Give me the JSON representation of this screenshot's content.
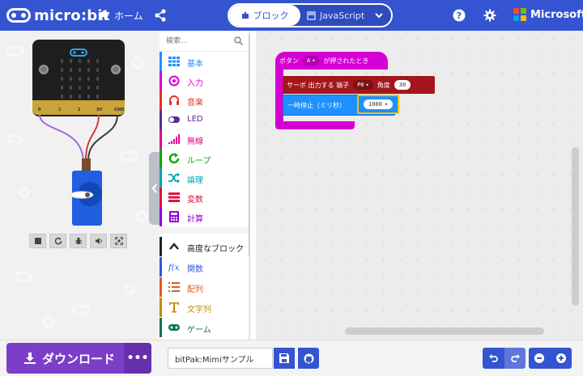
{
  "header": {
    "logo_text": "micro:bit",
    "home_label": "ホーム",
    "mode_blocks_label": "ブロック",
    "mode_js_label": "JavaScript",
    "brand_label": "Microsoft"
  },
  "simulator": {
    "pins": [
      "0",
      "1",
      "2",
      "3V",
      "GND"
    ]
  },
  "toolbox": {
    "search_placeholder": "検索...",
    "categories": [
      {
        "label": "基本",
        "color": "#1e90ff",
        "icon": "grid-icon"
      },
      {
        "label": "入力",
        "color": "#d400d4",
        "icon": "circle-target-icon"
      },
      {
        "label": "音楽",
        "color": "#e63022",
        "icon": "headphones-icon"
      },
      {
        "label": "LED",
        "color": "#5c2d91",
        "icon": "toggle-icon"
      },
      {
        "label": "無線",
        "color": "#e3008c",
        "icon": "signal-bars-icon"
      },
      {
        "label": "ループ",
        "color": "#00aa00",
        "icon": "refresh-icon"
      },
      {
        "label": "論理",
        "color": "#00a4a6",
        "icon": "shuffle-icon"
      },
      {
        "label": "変数",
        "color": "#dc143c",
        "icon": "list-lines-icon"
      },
      {
        "label": "計算",
        "color": "#9400d3",
        "icon": "calculator-icon"
      },
      {
        "label": "高度なブロック",
        "color": "#212121",
        "icon": "chevron-up-icon"
      },
      {
        "label": "関数",
        "color": "#3455db",
        "icon": "function-icon"
      },
      {
        "label": "配列",
        "color": "#e65722",
        "icon": "list-numbered-icon"
      },
      {
        "label": "文字列",
        "color": "#c08c00",
        "icon": "text-icon"
      },
      {
        "label": "ゲーム",
        "color": "#007a4b",
        "icon": "gamepad-icon"
      }
    ]
  },
  "workspace": {
    "hat_block": {
      "prefix": "ボタン",
      "button": "A",
      "suffix": "が押されたとき",
      "color": "#d400d4"
    },
    "servo_block": {
      "label": "サーボ 出力する 端子",
      "pin": "P0",
      "angle_label": "角度",
      "angle_value": "30",
      "color": "#a4161b"
    },
    "pause_block": {
      "label": "一時停止（ミリ秒）",
      "value": "1000",
      "color": "#1e90ff"
    }
  },
  "footer": {
    "download_label": "ダウンロード",
    "more_label": "•••",
    "project_name": "bitPak:Mimiサンプル"
  }
}
